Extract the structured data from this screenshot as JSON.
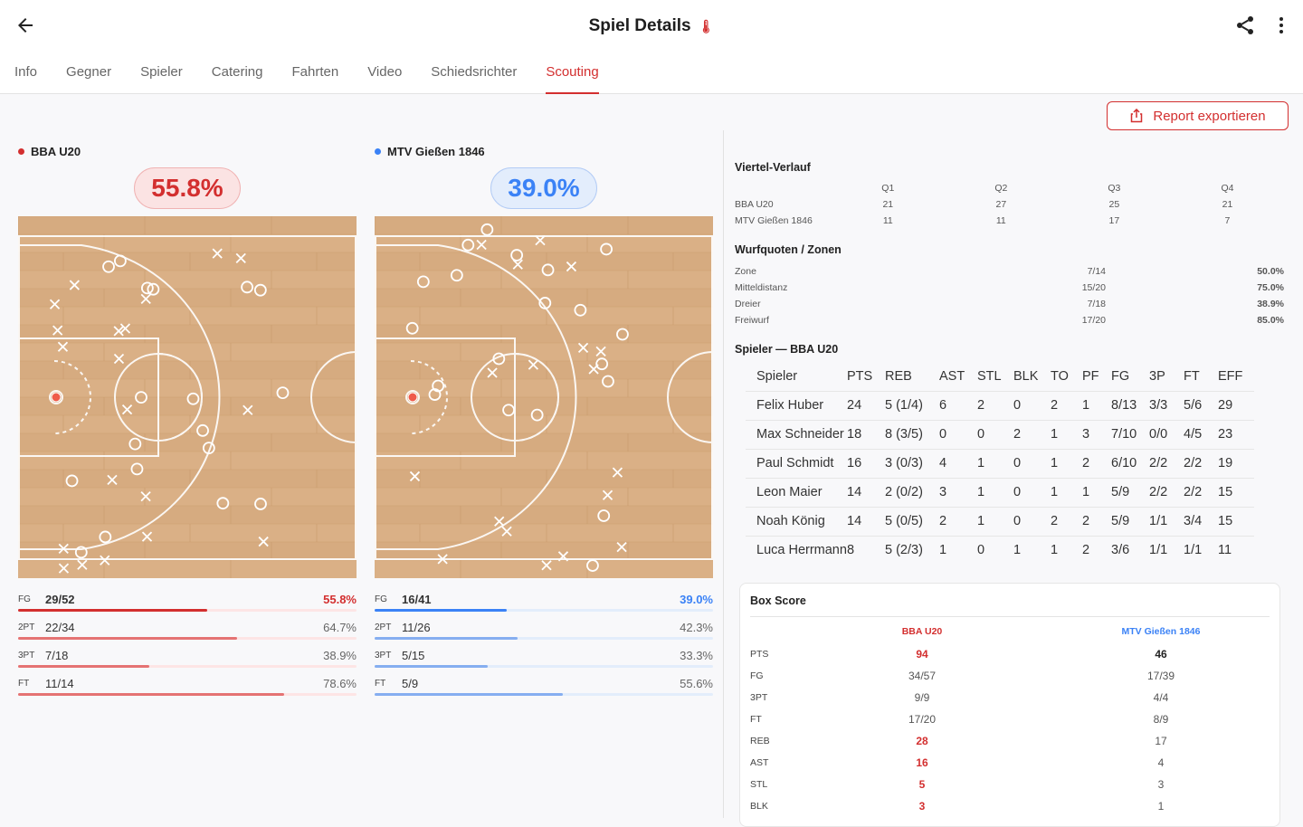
{
  "header": {
    "title": "Spiel Details",
    "temp_glyph": "🌡"
  },
  "tabs": [
    "Info",
    "Gegner",
    "Spieler",
    "Catering",
    "Fahrten",
    "Video",
    "Schiedsrichter",
    "Scouting"
  ],
  "active_tab": "Scouting",
  "export_label": "Report exportieren",
  "colors": {
    "accent": "#d32f2f",
    "home": "#d32f2f",
    "away": "#3b82f6",
    "court": "#d9ae82"
  },
  "teams": [
    {
      "name": "BBA U20",
      "pct": "55.8%",
      "stats": [
        {
          "label": "FG",
          "made": "29/52",
          "pct": "55.8%",
          "fraction": 0.558
        },
        {
          "label": "2PT",
          "made": "22/34",
          "pct": "64.7%",
          "fraction": 0.647
        },
        {
          "label": "3PT",
          "made": "7/18",
          "pct": "38.9%",
          "fraction": 0.389
        },
        {
          "label": "FT",
          "made": "11/14",
          "pct": "78.6%",
          "fraction": 0.786
        }
      ]
    },
    {
      "name": "MTV Gießen 1846",
      "pct": "39.0%",
      "stats": [
        {
          "label": "FG",
          "made": "16/41",
          "pct": "39.0%",
          "fraction": 0.39
        },
        {
          "label": "2PT",
          "made": "11/26",
          "pct": "42.3%",
          "fraction": 0.423
        },
        {
          "label": "3PT",
          "made": "5/15",
          "pct": "33.3%",
          "fraction": 0.333
        },
        {
          "label": "FT",
          "made": "5/9",
          "pct": "55.6%",
          "fraction": 0.556
        }
      ]
    }
  ],
  "quarters": {
    "title": "Viertel-Verlauf",
    "headers": [
      "Q1",
      "Q2",
      "Q3",
      "Q4"
    ],
    "rows": [
      {
        "team": "BBA U20",
        "values": [
          "21",
          "27",
          "25",
          "21"
        ]
      },
      {
        "team": "MTV Gießen 1846",
        "values": [
          "11",
          "11",
          "17",
          "7"
        ]
      }
    ]
  },
  "zones": {
    "title": "Wurfquoten / Zonen",
    "rows": [
      {
        "zone": "Zone",
        "made": "7/14",
        "pct": "50.0%"
      },
      {
        "zone": "Mitteldistanz",
        "made": "15/20",
        "pct": "75.0%"
      },
      {
        "zone": "Dreier",
        "made": "7/18",
        "pct": "38.9%"
      },
      {
        "zone": "Freiwurf",
        "made": "17/20",
        "pct": "85.0%"
      }
    ]
  },
  "players": {
    "title": "Spieler — BBA U20",
    "headers": [
      "Spieler",
      "PTS",
      "REB",
      "AST",
      "STL",
      "BLK",
      "TO",
      "PF",
      "FG",
      "3P",
      "FT",
      "EFF"
    ],
    "rows": [
      [
        "Felix Huber",
        "24",
        "5 (1/4)",
        "6",
        "2",
        "0",
        "2",
        "1",
        "8/13",
        "3/3",
        "5/6",
        "29"
      ],
      [
        "Max Schneider",
        "18",
        "8 (3/5)",
        "0",
        "0",
        "2",
        "1",
        "3",
        "7/10",
        "0/0",
        "4/5",
        "23"
      ],
      [
        "Paul Schmidt",
        "16",
        "3 (0/3)",
        "4",
        "1",
        "0",
        "1",
        "2",
        "6/10",
        "2/2",
        "2/2",
        "19"
      ],
      [
        "Leon Maier",
        "14",
        "2 (0/2)",
        "3",
        "1",
        "0",
        "1",
        "1",
        "5/9",
        "2/2",
        "2/2",
        "15"
      ],
      [
        "Noah König",
        "14",
        "5 (0/5)",
        "2",
        "1",
        "0",
        "2",
        "2",
        "5/9",
        "1/1",
        "3/4",
        "15"
      ],
      [
        "Luca Herrmann",
        "8",
        "5 (2/3)",
        "1",
        "0",
        "1",
        "1",
        "2",
        "3/6",
        "1/1",
        "1/1",
        "11"
      ]
    ]
  },
  "boxscore": {
    "title": "Box Score",
    "team_a": "BBA U20",
    "team_b": "MTV Gießen 1846",
    "rows": [
      {
        "k": "PTS",
        "a": "94",
        "b": "46",
        "a_hl": true,
        "b_hl": true
      },
      {
        "k": "FG",
        "a": "34/57",
        "b": "17/39"
      },
      {
        "k": "3PT",
        "a": "9/9",
        "b": "4/4"
      },
      {
        "k": "FT",
        "a": "17/20",
        "b": "8/9"
      },
      {
        "k": "REB",
        "a": "28",
        "b": "17",
        "a_hl": true
      },
      {
        "k": "AST",
        "a": "16",
        "b": "4",
        "a_hl": true
      },
      {
        "k": "STL",
        "a": "5",
        "b": "3",
        "a_hl": true
      },
      {
        "k": "BLK",
        "a": "3",
        "b": "1",
        "a_hl": true
      }
    ]
  }
}
